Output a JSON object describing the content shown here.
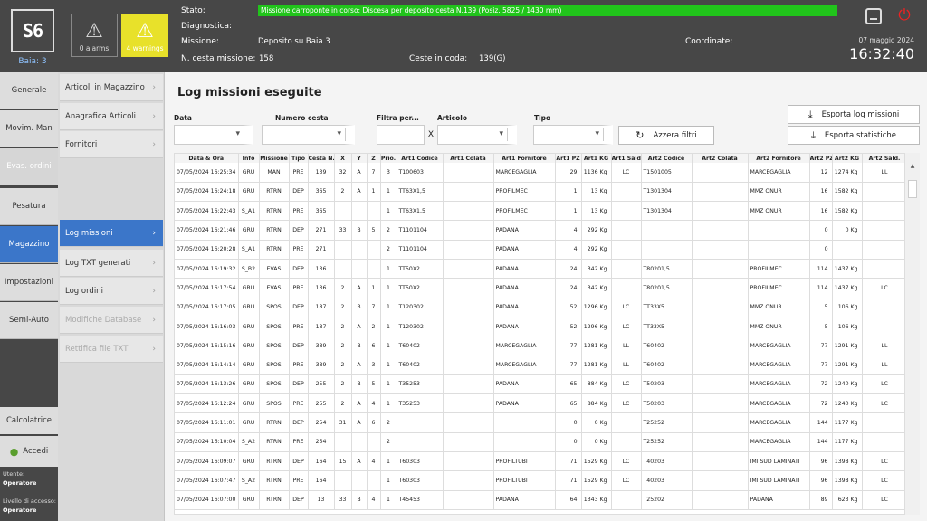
{
  "header": {
    "logo_text": "S6",
    "bay": "Baia: 3",
    "alarms_label": "0 alarms",
    "warnings_label": "4 warnings",
    "stato_label": "Stato:",
    "stato_value": "Missione carroponte in corso: Discesa per deposito cesta N.139 (Posiz. 5825 / 1430 mm)",
    "diagnostica_label": "Diagnostica:",
    "missione_label": "Missione:",
    "missione_value": "Deposito su Baia 3",
    "ncesta_label": "N. cesta missione:",
    "ncesta_value": "158",
    "coda_label": "Ceste in coda:",
    "coda_value": "139(G)",
    "coordinate_label": "Coordinate:",
    "date": "07 maggio 2024",
    "time": "16:32:40",
    "colors": {
      "header_bg": "#474747",
      "stato_bar": "#21c41b",
      "warning": "#e8e12a",
      "accent": "#3b76c9"
    }
  },
  "sidebar": {
    "items": [
      {
        "label": "Generale"
      },
      {
        "label": "Movim. Man"
      },
      {
        "label": "Evas. ordini"
      },
      {
        "label": "Pesatura"
      },
      {
        "label": "Magazzino"
      },
      {
        "label": "Impostazioni"
      },
      {
        "label": "Semi-Auto"
      }
    ],
    "calc_label": "Calcolatrice",
    "login_label": "Accedi",
    "user_label": "Utente:",
    "user_value": "Operatore",
    "access_label": "Livello di accesso:",
    "access_value": "Operatore"
  },
  "submenu": {
    "items": [
      {
        "label": "Articoli in Magazzino"
      },
      {
        "label": "Anagrafica Articoli"
      },
      {
        "label": "Fornitori"
      },
      {
        "label": "Log missioni"
      },
      {
        "label": "Log TXT generati"
      },
      {
        "label": "Log ordini"
      },
      {
        "label": "Modifiche Database"
      },
      {
        "label": "Rettifica file TXT"
      }
    ]
  },
  "main": {
    "title": "Log missioni eseguite",
    "filters": {
      "data_label": "Data",
      "cesta_label": "Numero cesta",
      "filtra_label": "Filtra per...",
      "articolo_label": "Articolo",
      "tipo_label": "Tipo",
      "clear_x": "X",
      "azzera_label": "Azzera filtri"
    },
    "export_log_label": "Esporta log missioni",
    "export_stats_label": "Esporta statistiche",
    "columns": [
      "Data & Ora",
      "Info",
      "Missione",
      "Tipo",
      "Cesta N.",
      "X",
      "Y",
      "Z",
      "Prio.",
      "Art1 Codice",
      "Art1 Colata",
      "Art1 Fornitore",
      "Art1 PZ",
      "Art1 KG",
      "Art1 Sald.",
      "Art2 Codice",
      "Art2 Colata",
      "Art2 Fornitore",
      "Art2 PZ",
      "Art2 KG",
      "Art2 Sald."
    ],
    "rows": [
      [
        "07/05/2024 16:25:34",
        "GRU",
        "MAN",
        "PRE",
        "139",
        "32",
        "A",
        "7",
        "3",
        "T100603",
        "",
        "MARCEGAGLIA",
        "29",
        "1136 Kg",
        "LC",
        "T1501005",
        "",
        "MARCEGAGLIA",
        "12",
        "1274 Kg",
        "LL"
      ],
      [
        "07/05/2024 16:24:18",
        "GRU",
        "RTRN",
        "DEP",
        "365",
        "2",
        "A",
        "1",
        "1",
        "TT63X1,5",
        "",
        "PROFILMEC",
        "1",
        "13 Kg",
        "",
        "T1301304",
        "",
        "MMZ ONUR",
        "16",
        "1582 Kg",
        ""
      ],
      [
        "07/05/2024 16:22:43",
        "S_A1",
        "RTRN",
        "PRE",
        "365",
        "",
        "",
        "",
        "1",
        "TT63X1,5",
        "",
        "PROFILMEC",
        "1",
        "13 Kg",
        "",
        "T1301304",
        "",
        "MMZ ONUR",
        "16",
        "1582 Kg",
        ""
      ],
      [
        "07/05/2024 16:21:46",
        "GRU",
        "RTRN",
        "DEP",
        "271",
        "33",
        "B",
        "5",
        "2",
        "T1101104",
        "",
        "PADANA",
        "4",
        "292 Kg",
        "",
        "",
        "",
        "",
        "0",
        "0 Kg",
        ""
      ],
      [
        "07/05/2024 16:20:28",
        "S_A1",
        "RTRN",
        "PRE",
        "271",
        "",
        "",
        "",
        "2",
        "T1101104",
        "",
        "PADANA",
        "4",
        "292 Kg",
        "",
        "",
        "",
        "",
        "0",
        "",
        ""
      ],
      [
        "07/05/2024 16:19:32",
        "S_B2",
        "EVAS",
        "DEP",
        "136",
        "",
        "",
        "",
        "1",
        "TT50X2",
        "",
        "PADANA",
        "24",
        "342 Kg",
        "",
        "T80201,5",
        "",
        "PROFILMEC",
        "114",
        "1437 Kg",
        ""
      ],
      [
        "07/05/2024 16:17:54",
        "GRU",
        "EVAS",
        "PRE",
        "136",
        "2",
        "A",
        "1",
        "1",
        "TT50X2",
        "",
        "PADANA",
        "24",
        "342 Kg",
        "",
        "T80201,5",
        "",
        "PROFILMEC",
        "114",
        "1437 Kg",
        "LC"
      ],
      [
        "07/05/2024 16:17:05",
        "GRU",
        "SPOS",
        "DEP",
        "187",
        "2",
        "B",
        "7",
        "1",
        "T120302",
        "",
        "PADANA",
        "52",
        "1296 Kg",
        "LC",
        "TT33X5",
        "",
        "MMZ ONUR",
        "5",
        "106 Kg",
        ""
      ],
      [
        "07/05/2024 16:16:03",
        "GRU",
        "SPOS",
        "PRE",
        "187",
        "2",
        "A",
        "2",
        "1",
        "T120302",
        "",
        "PADANA",
        "52",
        "1296 Kg",
        "LC",
        "TT33X5",
        "",
        "MMZ ONUR",
        "5",
        "106 Kg",
        ""
      ],
      [
        "07/05/2024 16:15:16",
        "GRU",
        "SPOS",
        "DEP",
        "389",
        "2",
        "B",
        "6",
        "1",
        "T60402",
        "",
        "MARCEGAGLIA",
        "77",
        "1281 Kg",
        "LL",
        "T60402",
        "",
        "MARCEGAGLIA",
        "77",
        "1291 Kg",
        "LL"
      ],
      [
        "07/05/2024 16:14:14",
        "GRU",
        "SPOS",
        "PRE",
        "389",
        "2",
        "A",
        "3",
        "1",
        "T60402",
        "",
        "MARCEGAGLIA",
        "77",
        "1281 Kg",
        "LL",
        "T60402",
        "",
        "MARCEGAGLIA",
        "77",
        "1291 Kg",
        "LL"
      ],
      [
        "07/05/2024 16:13:26",
        "GRU",
        "SPOS",
        "DEP",
        "255",
        "2",
        "B",
        "5",
        "1",
        "T35253",
        "",
        "PADANA",
        "65",
        "884 Kg",
        "LC",
        "T50203",
        "",
        "MARCEGAGLIA",
        "72",
        "1240 Kg",
        "LC"
      ],
      [
        "07/05/2024 16:12:24",
        "GRU",
        "SPOS",
        "PRE",
        "255",
        "2",
        "A",
        "4",
        "1",
        "T35253",
        "",
        "PADANA",
        "65",
        "884 Kg",
        "LC",
        "T50203",
        "",
        "MARCEGAGLIA",
        "72",
        "1240 Kg",
        "LC"
      ],
      [
        "07/05/2024 16:11:01",
        "GRU",
        "RTRN",
        "DEP",
        "254",
        "31",
        "A",
        "6",
        "2",
        "",
        "",
        "",
        "0",
        "0 Kg",
        "",
        "T25252",
        "",
        "MARCEGAGLIA",
        "144",
        "1177 Kg",
        ""
      ],
      [
        "07/05/2024 16:10:04",
        "S_A2",
        "RTRN",
        "PRE",
        "254",
        "",
        "",
        "",
        "2",
        "",
        "",
        "",
        "0",
        "0 Kg",
        "",
        "T25252",
        "",
        "MARCEGAGLIA",
        "144",
        "1177 Kg",
        ""
      ],
      [
        "07/05/2024 16:09:07",
        "GRU",
        "RTRN",
        "DEP",
        "164",
        "15",
        "A",
        "4",
        "1",
        "T60303",
        "",
        "PROFILTUBI",
        "71",
        "1529 Kg",
        "LC",
        "T40203",
        "",
        "IMI SUD LAMINATI",
        "96",
        "1398 Kg",
        "LC"
      ],
      [
        "07/05/2024 16:07:47",
        "S_A2",
        "RTRN",
        "PRE",
        "164",
        "",
        "",
        "",
        "1",
        "T60303",
        "",
        "PROFILTUBI",
        "71",
        "1529 Kg",
        "LC",
        "T40203",
        "",
        "IMI SUD LAMINATI",
        "96",
        "1398 Kg",
        "LC"
      ],
      [
        "07/05/2024 16:07:00",
        "GRU",
        "RTRN",
        "DEP",
        "13",
        "33",
        "B",
        "4",
        "1",
        "T45453",
        "",
        "PADANA",
        "64",
        "1343 Kg",
        "",
        "T25202",
        "",
        "PADANA",
        "89",
        "623 Kg",
        "LC"
      ]
    ]
  }
}
